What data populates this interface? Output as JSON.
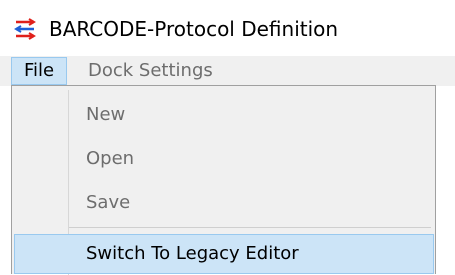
{
  "window": {
    "title": "BARCODE-Protocol Definition",
    "icon": "red-blue-arrows-app-icon"
  },
  "menubar": {
    "items": [
      {
        "label": "File",
        "state": "open"
      },
      {
        "label": "Dock Settings",
        "state": "normal"
      }
    ]
  },
  "file_menu": {
    "items": [
      {
        "label": "New",
        "enabled": false
      },
      {
        "label": "Open",
        "enabled": false
      },
      {
        "label": "Save",
        "enabled": false
      },
      {
        "label": "Switch To Legacy Editor",
        "enabled": true,
        "highlighted": true
      }
    ]
  },
  "colors": {
    "highlight_fill": "#cce4f7",
    "highlight_border": "#99c9ef",
    "menu_background": "#f0f0f0",
    "disabled_text": "#6d6d6d",
    "icon_red": "#e0201b",
    "icon_blue": "#1f5fd6"
  }
}
